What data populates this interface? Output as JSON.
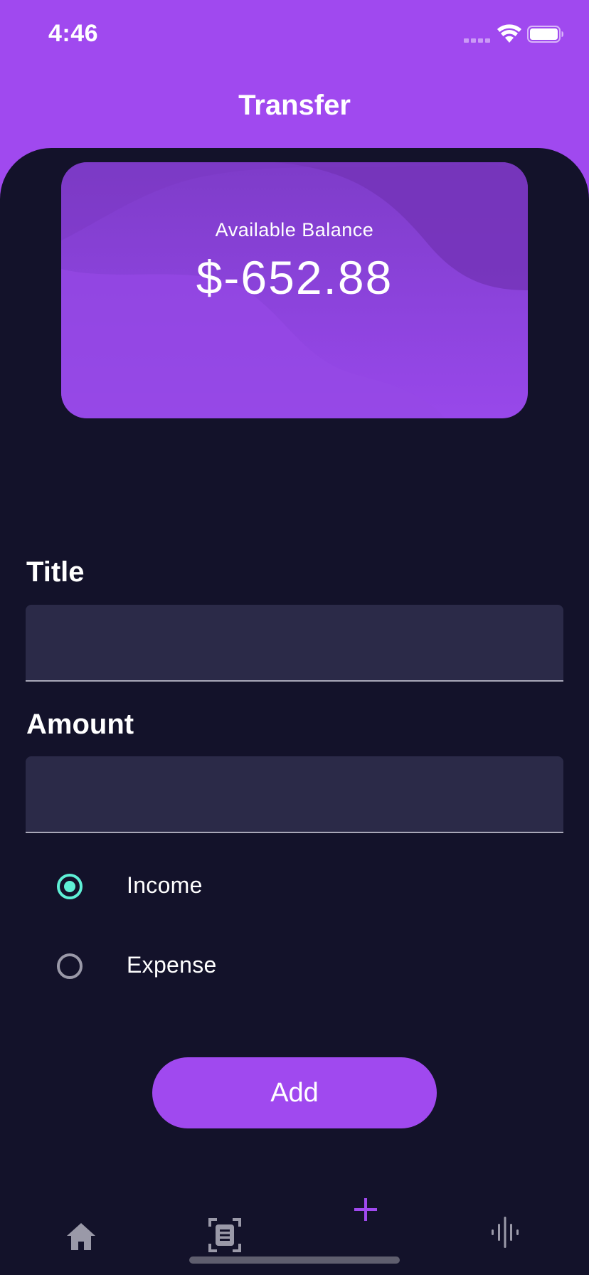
{
  "status_bar": {
    "time": "4:46",
    "signal_icon": "cellular-signal-icon",
    "wifi_icon": "wifi-icon",
    "battery_icon": "battery-icon"
  },
  "header": {
    "title": "Transfer"
  },
  "balance_card": {
    "label": "Available Balance",
    "value": "$-652.88"
  },
  "form": {
    "title_field": {
      "label": "Title",
      "value": "",
      "placeholder": ""
    },
    "amount_field": {
      "label": "Amount",
      "value": "",
      "placeholder": ""
    },
    "type_options": [
      {
        "label": "Income",
        "selected": true
      },
      {
        "label": "Expense",
        "selected": false
      }
    ],
    "submit_label": "Add"
  },
  "bottom_nav": {
    "items": [
      {
        "icon": "home-icon"
      },
      {
        "icon": "document-scan-icon"
      },
      {
        "icon": "plus-icon",
        "active": true
      },
      {
        "icon": "audio-waveform-icon"
      }
    ]
  },
  "colors": {
    "accent": "#a049ef",
    "background": "#13122a",
    "field": "#2b2a48",
    "radio_selected": "#5ff0d6"
  }
}
